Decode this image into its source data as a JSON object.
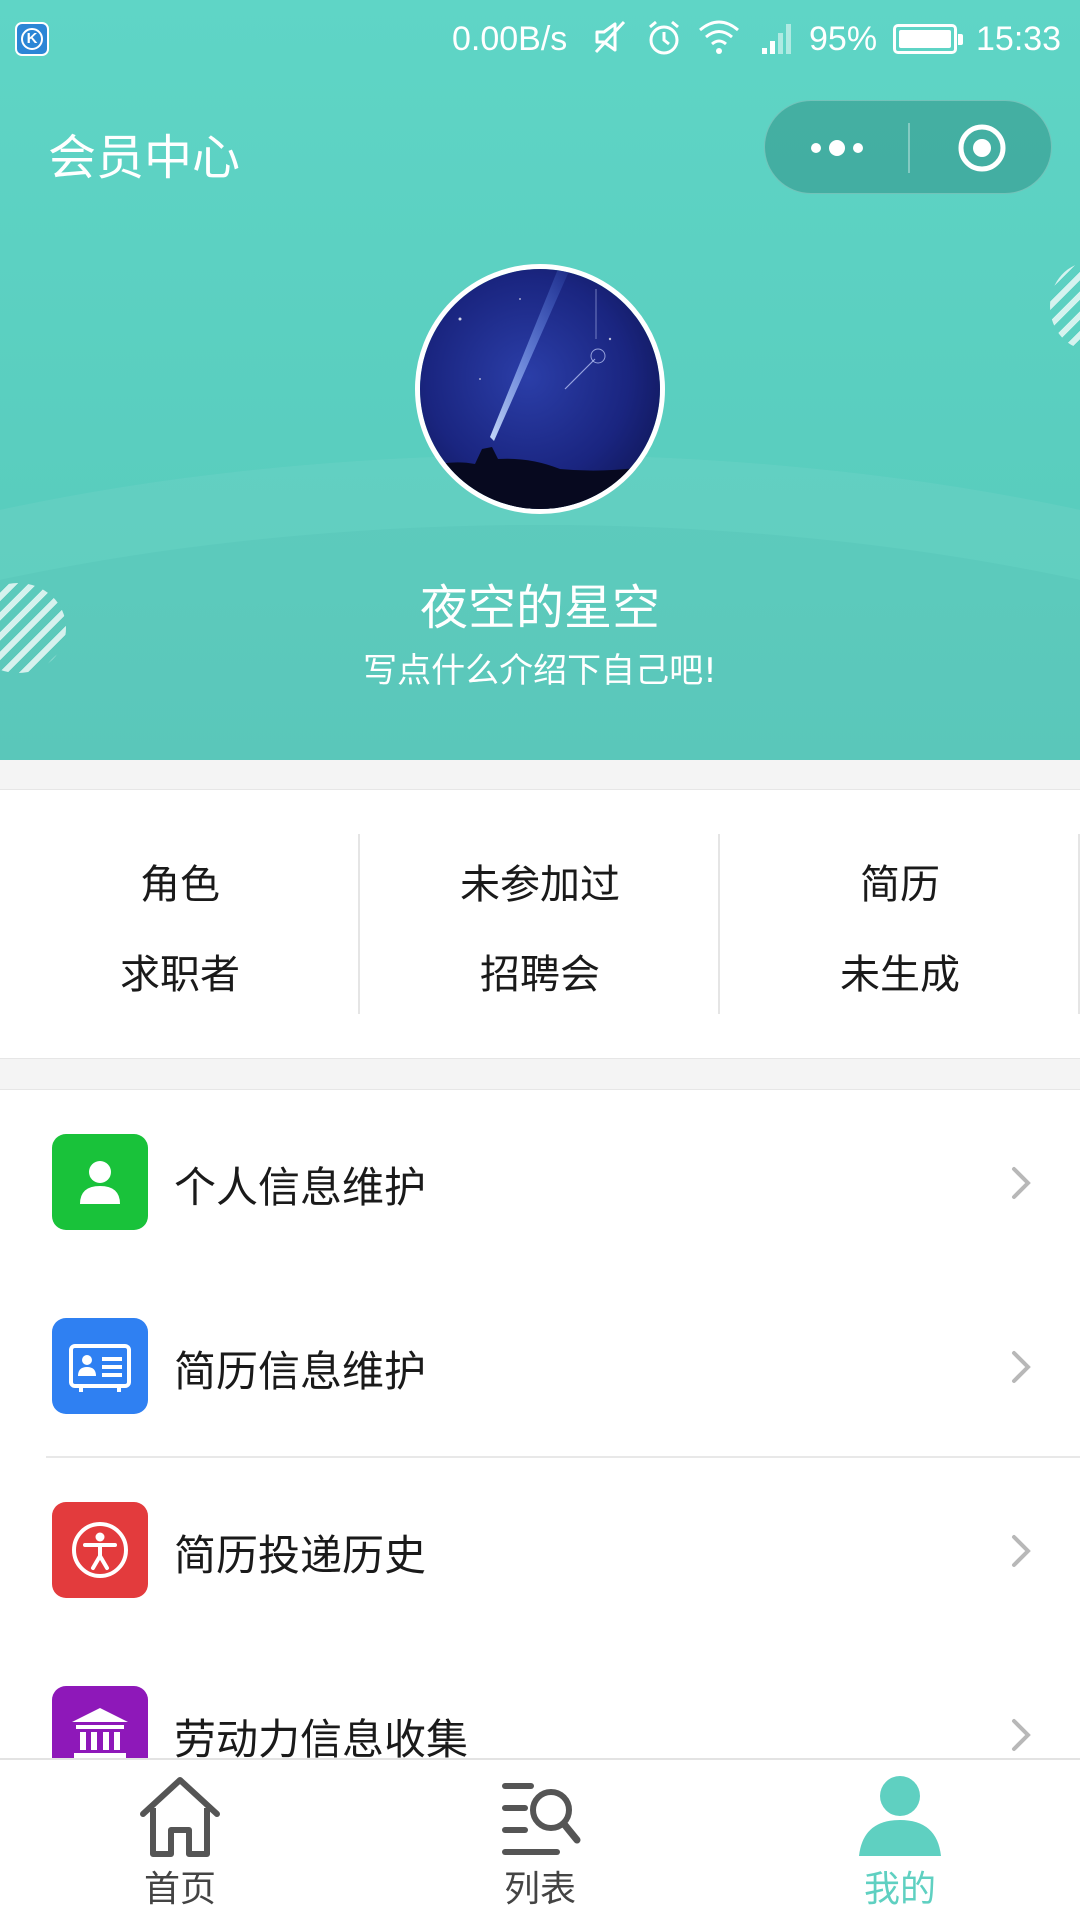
{
  "status_bar": {
    "net_speed": "0.00B/s",
    "battery_percent": "95%",
    "battery_level": 0.95,
    "time": "15:33"
  },
  "header": {
    "title": "会员中心"
  },
  "profile": {
    "name": "夜空的星空",
    "bio": "写点什么介绍下自己吧!"
  },
  "stats": [
    {
      "top": "角色",
      "bottom": "求职者"
    },
    {
      "top": "未参加过",
      "bottom": "招聘会"
    },
    {
      "top": "简历",
      "bottom": "未生成"
    }
  ],
  "menu": [
    {
      "label": "个人信息维护",
      "icon": "person-icon",
      "color": "#19c23a"
    },
    {
      "label": "简历信息维护",
      "icon": "id-card-icon",
      "color": "#2f80f2"
    },
    {
      "label": "简历投递历史",
      "icon": "accessibility-icon",
      "color": "#e33b3d"
    },
    {
      "label": "劳动力信息收集",
      "icon": "bank-icon",
      "color": "#8e18b9"
    }
  ],
  "tabbar": [
    {
      "label": "首页",
      "icon": "home-icon",
      "active": false
    },
    {
      "label": "列表",
      "icon": "list-search-icon",
      "active": false
    },
    {
      "label": "我的",
      "icon": "user-icon",
      "active": true
    }
  ],
  "colors": {
    "accent": "#5fd0c1",
    "header_bg": "#5fd5c6"
  }
}
